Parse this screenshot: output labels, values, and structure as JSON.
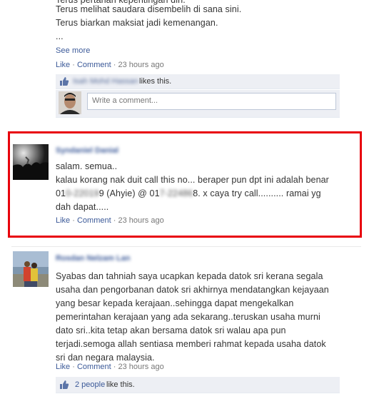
{
  "post1": {
    "line0": "Terus pertahan kepentingan diri.",
    "line1": "Terus melihat saudara disembelih di sana sini.",
    "line2": "Terus biarkan maksiat jadi kemenangan.",
    "line3": "...",
    "see_more": "See more",
    "like_label": "Like",
    "comment_label": "Comment",
    "sep": "·",
    "time": "23 hours ago",
    "liker_name": "Isah Mohd Hassan",
    "likes_suffix": "likes this.",
    "comment_placeholder": "Write a comment..."
  },
  "post2": {
    "author": "Syndaniel Danial",
    "line1": "salam. semua..",
    "line2": "kalau korang nak duit call this no... beraper pun dpt ini adalah benar",
    "line3a": "01",
    "line3b": "0-22019",
    "line3c": "9 (Ahyie) @ 01",
    "line3d": "7-22486",
    "line3e": "8. x caya try call.......... ramai yg",
    "line4": "dah dapat.....",
    "like_label": "Like",
    "comment_label": "Comment",
    "sep": "·",
    "time": "23 hours ago"
  },
  "post3": {
    "author": "Rosdan Nelzam Lan",
    "lines": [
      "Syabas dan tahniah saya ucapkan kepada datok sri kerana segala",
      "usaha dan pengorbanan datok sri akhirnya mendatangkan kejayaan",
      "yang besar kepada kerajaan..sehingga dapat mengekalkan",
      "pemerintahan kerajaan yang ada sekarang..teruskan usaha murni",
      "dato sri..kita tetap akan bersama datok sri walau apa pun",
      "terjadi.semoga allah sentiasa memberi rahmat kepada usaha datok",
      "sri dan negara malaysia."
    ],
    "like_label": "Like",
    "comment_label": "Comment",
    "sep": "·",
    "time": "23 hours ago",
    "likes_count": "2 people",
    "likes_suffix": "like this."
  },
  "colors": {
    "link": "#3b5998",
    "highlight_border": "#e8000b",
    "likes_bg": "#edeff4"
  },
  "icons": [
    "thumbs-up-icon",
    "user-avatar"
  ]
}
